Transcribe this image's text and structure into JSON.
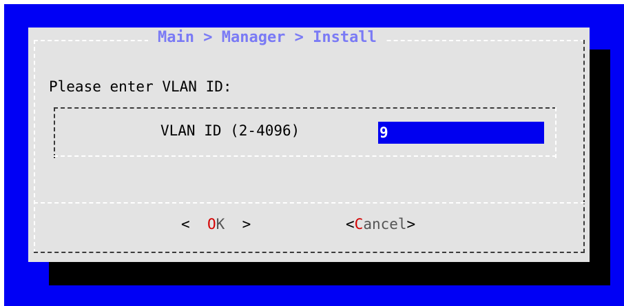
{
  "dialog": {
    "title": "Main > Manager > Install",
    "prompt": "Please enter VLAN ID:"
  },
  "field": {
    "label": "VLAN ID (2-4096)",
    "value": "9"
  },
  "buttons": {
    "ok": {
      "open": "<",
      "hotkey": "O",
      "rest": "K",
      "close": ">"
    },
    "cancel": {
      "open": "<",
      "hotkey": "C",
      "rest": "ancel",
      "close": ">"
    }
  },
  "colors": {
    "screen_background": "#0000f5",
    "dialog_background": "#e3e3e3",
    "title": "#7a7af5",
    "input_background": "#0000f0",
    "hotkey": "#d40000"
  }
}
